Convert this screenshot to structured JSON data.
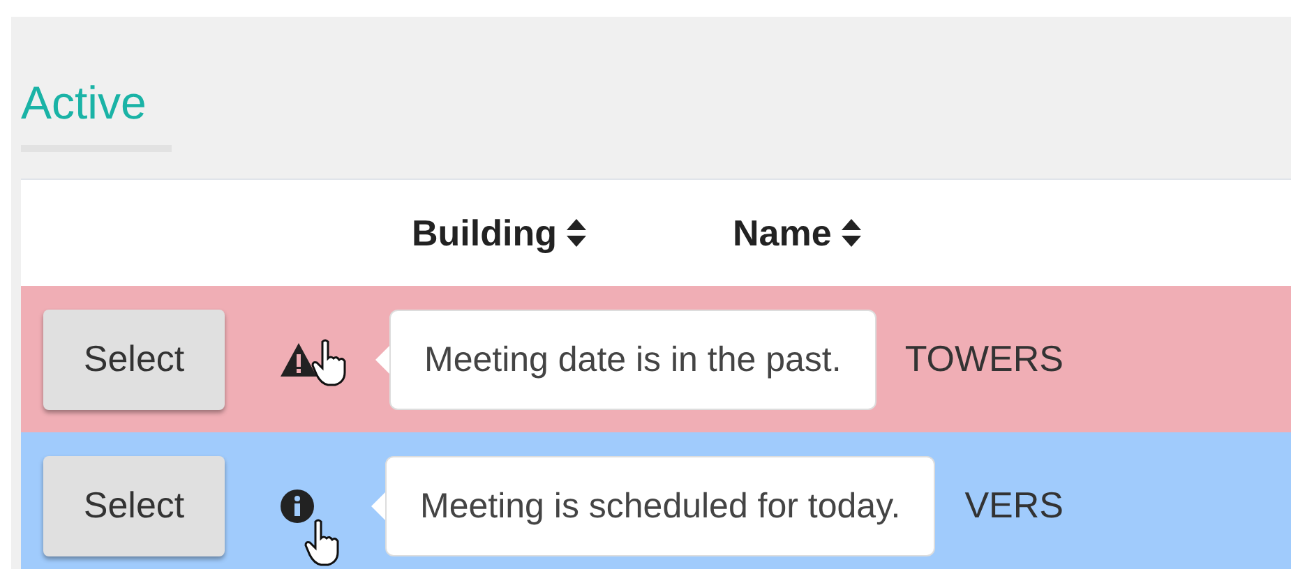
{
  "section_title": "Active",
  "table": {
    "columns": [
      {
        "label": "Building",
        "sortable": true
      },
      {
        "label": "Name",
        "sortable": true
      }
    ],
    "rows": [
      {
        "kind": "warning",
        "button": "Select",
        "name": "TOWERS",
        "tooltip": "Meeting date is in the past."
      },
      {
        "kind": "info",
        "button": "Select",
        "name": "VERS",
        "tooltip": "Meeting is scheduled for today."
      }
    ]
  }
}
